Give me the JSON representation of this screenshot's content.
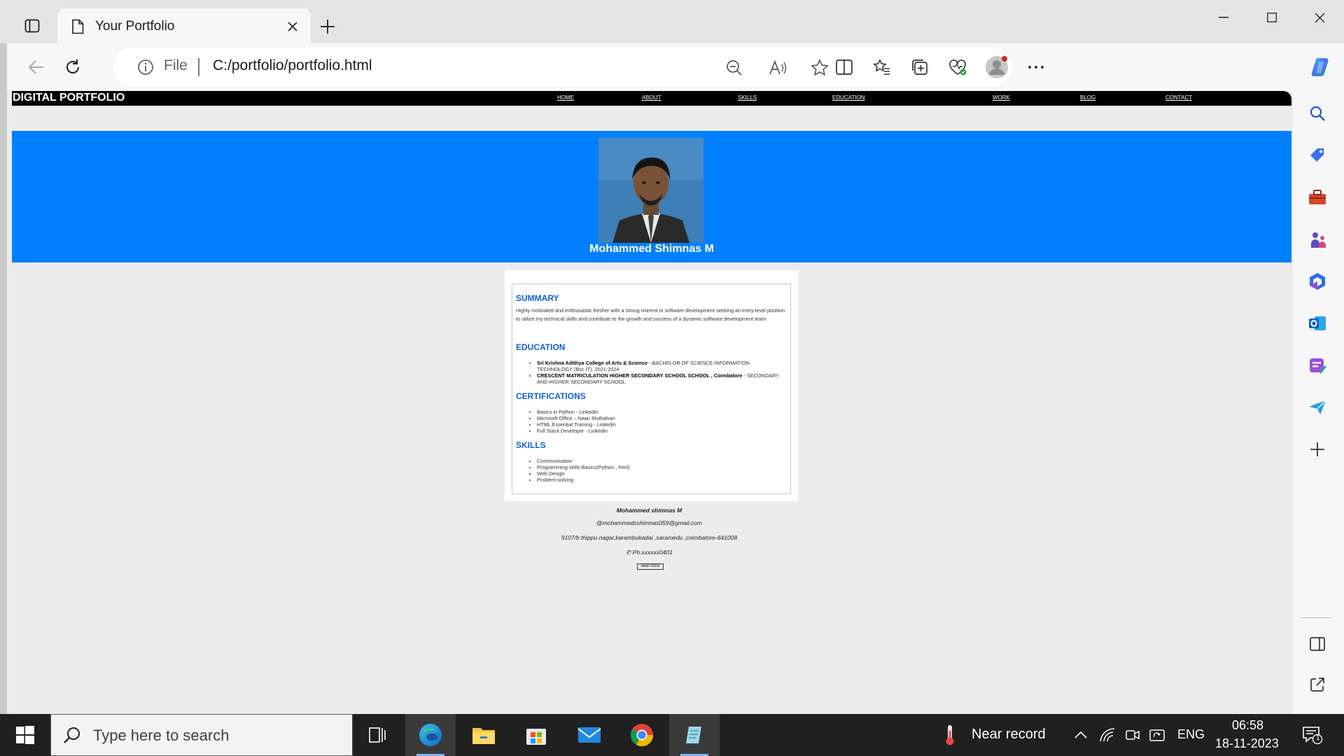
{
  "browser": {
    "tab_title": "Your Portfolio",
    "address_scheme": "File",
    "address_url": "C:/portfolio/portfolio.html"
  },
  "site": {
    "logo": "DIGITAL PORTFOLIO",
    "nav": [
      "HOME",
      "ABOUT",
      "SKILLS",
      "EDUCATION",
      "WORK",
      "BLOG",
      "CONTACT"
    ],
    "hero_name": "Mohammed Shimnas M",
    "summary_title": "SUMMARY",
    "summary_text": "Highly motivated and enthusiastic fresher with a strong interest in software development seeking an entry-level position to utilize my technical skills and contribute to the growth and success of a dynamic software development team",
    "education_title": "EDUCATION",
    "education": [
      {
        "institution": "Sri Krishna Adithya College of Arts & Science",
        "detail": " - BACHELOR OF SCIENCE INFORMATION TECHNOLOGY (Bsc IT), 2021-2024"
      },
      {
        "institution": "CRESCENT MATRICULATION HIGHER SECONDARY SCHOOL SCHOOL , Coimbatore",
        "detail": " - SECONDARY AND HIGHER SECONDARY SCHOOL"
      }
    ],
    "certifications_title": "CERTIFICATIONS",
    "certifications": [
      "Basics in Python - Linkedin",
      "Microsoft Office – Naan Muthalvan",
      "HTML Essential Training - Linkedin",
      "Full Stack Developer - Linkedin"
    ],
    "skills_title": "SKILLS",
    "skills": [
      "Communication",
      "Programming skills Basics(Python , html)",
      "Web Design",
      "Problem-solving"
    ],
    "contact": {
      "name": "Mohammed shimnas M",
      "email": "@mohammedsshimnas059@gmail.com",
      "address": "9107/b thippu nagar,karambukadai ,saramedu ,coimbatore-641008",
      "phone": "✆ Ph.xxxxxx0401",
      "button": "view more"
    }
  },
  "taskbar": {
    "search_placeholder": "Type here to search",
    "weather": "Near record",
    "language": "ENG",
    "time": "06:58",
    "date": "18-11-2023",
    "notifications": "1"
  }
}
